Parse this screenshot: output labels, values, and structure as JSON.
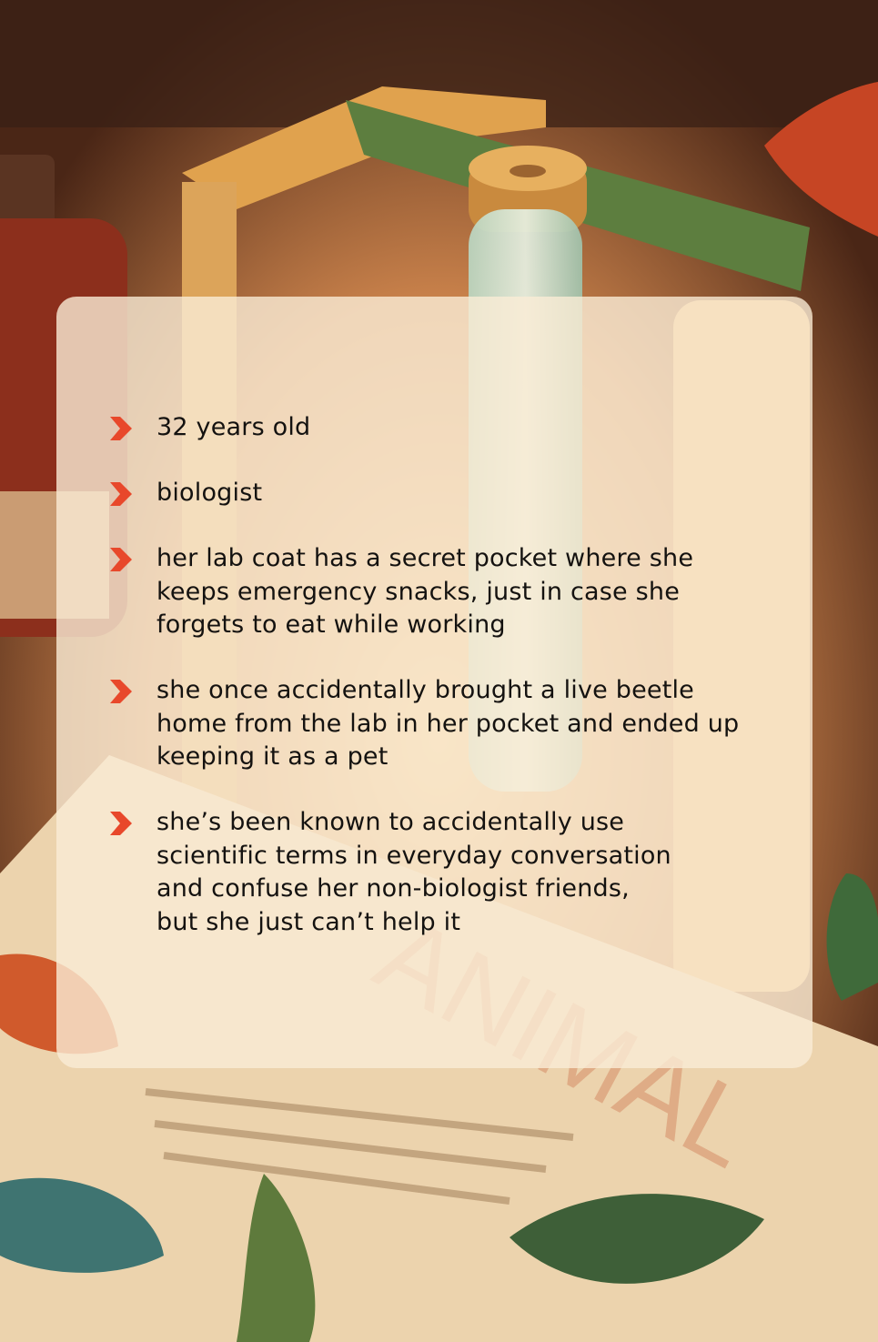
{
  "background": {
    "description_icons": [
      "test-tube-illustration",
      "leaf-illustration",
      "paper-document-illustration",
      "jar-illustration"
    ],
    "stamp_text": "ANIMAL"
  },
  "colors": {
    "bullet": "#e8482b",
    "card": "#faecd6",
    "text": "#141210"
  },
  "facts": [
    {
      "text": "32 years old"
    },
    {
      "text": "biologist"
    },
    {
      "text": "her lab coat has a secret pocket where she\nkeeps emergency snacks, just in case she\nforgets to eat while working"
    },
    {
      "text": "she once accidentally brought a live beetle\nhome from the lab in her pocket and ended up\nkeeping it as a pet"
    },
    {
      "text": "she’s been known to accidentally use\nscientific terms in everyday conversation\nand confuse her non-biologist friends,\nbut she just can’t help it"
    }
  ]
}
